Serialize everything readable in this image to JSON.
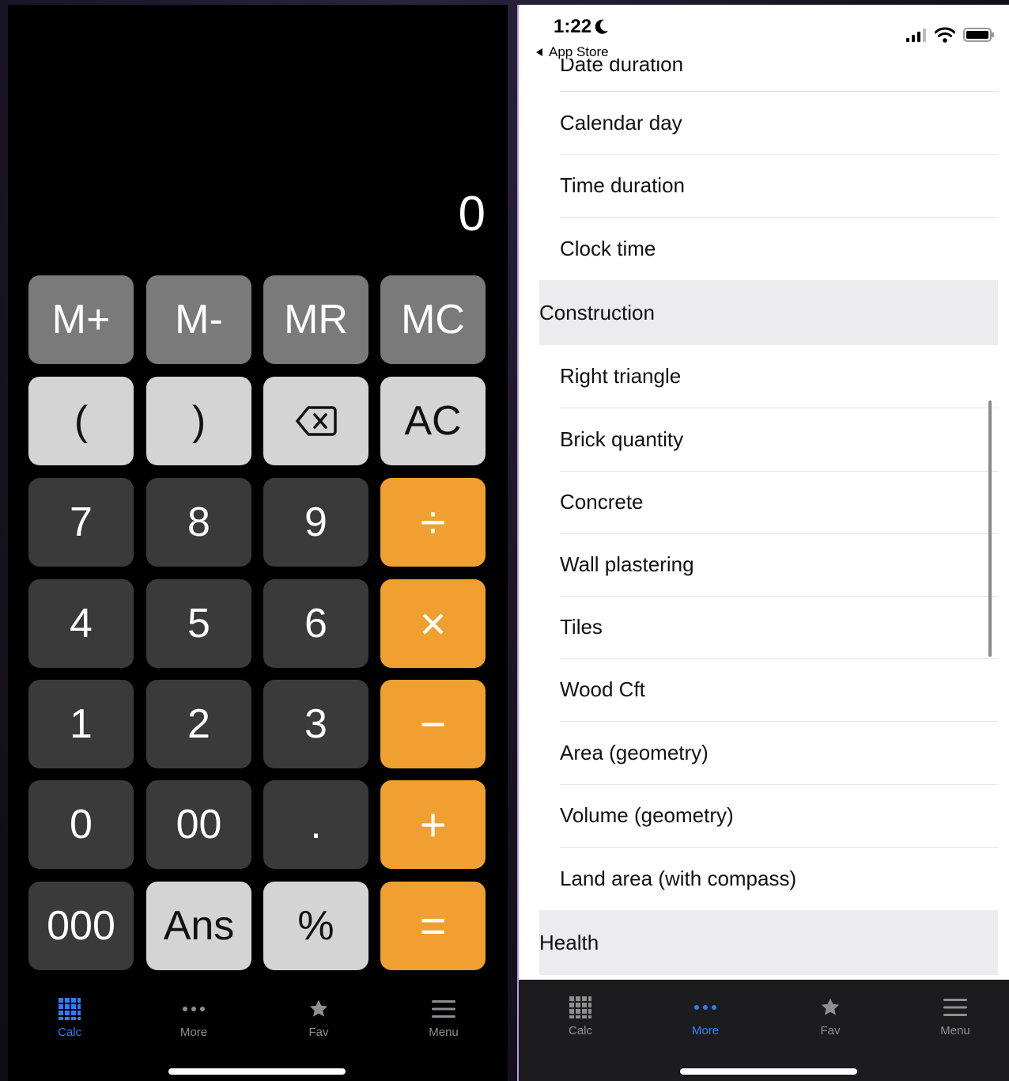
{
  "calculator": {
    "display_value": "0",
    "keys": {
      "m_plus": "M+",
      "m_minus": "M-",
      "mr": "MR",
      "mc": "MC",
      "open_paren": "(",
      "close_paren": ")",
      "ac": "AC",
      "seven": "7",
      "eight": "8",
      "nine": "9",
      "divide": "÷",
      "four": "4",
      "five": "5",
      "six": "6",
      "multiply": "×",
      "one": "1",
      "two": "2",
      "three": "3",
      "minus": "−",
      "zero": "0",
      "double_zero": "00",
      "dot": ".",
      "plus": "+",
      "triple_zero": "000",
      "ans": "Ans",
      "percent": "%",
      "equals": "="
    },
    "tabs": [
      {
        "label": "Calc",
        "icon": "grid-icon",
        "active": true
      },
      {
        "label": "More",
        "icon": "ellipsis-icon",
        "active": false
      },
      {
        "label": "Fav",
        "icon": "star-icon",
        "active": false
      },
      {
        "label": "Menu",
        "icon": "hamburger-icon",
        "active": false
      }
    ]
  },
  "list_screen": {
    "status": {
      "time": "1:22",
      "back_label": "App Store"
    },
    "cut_item": "Date duration",
    "items": [
      {
        "label": "Calendar day"
      },
      {
        "label": "Time duration"
      },
      {
        "label": "Clock time"
      }
    ],
    "sections": [
      {
        "title": "Construction",
        "items": [
          {
            "label": "Right triangle"
          },
          {
            "label": "Brick quantity"
          },
          {
            "label": "Concrete"
          },
          {
            "label": "Wall plastering"
          },
          {
            "label": "Tiles"
          },
          {
            "label": "Wood Cft"
          },
          {
            "label": "Area (geometry)"
          },
          {
            "label": "Volume (geometry)"
          },
          {
            "label": "Land area (with compass)"
          }
        ]
      },
      {
        "title": "Health",
        "items": []
      }
    ],
    "tabs": [
      {
        "label": "Calc",
        "icon": "grid-icon",
        "active": false
      },
      {
        "label": "More",
        "icon": "ellipsis-icon",
        "active": true
      },
      {
        "label": "Fav",
        "icon": "star-icon",
        "active": false
      },
      {
        "label": "Menu",
        "icon": "hamburger-icon",
        "active": false
      }
    ]
  },
  "colors": {
    "accent_blue": "#2f7ef0",
    "operator_orange": "#f0a030",
    "memory_gray": "#7a7a7a",
    "light_key": "#d4d4d4",
    "dark_key": "#3a3a3a"
  }
}
